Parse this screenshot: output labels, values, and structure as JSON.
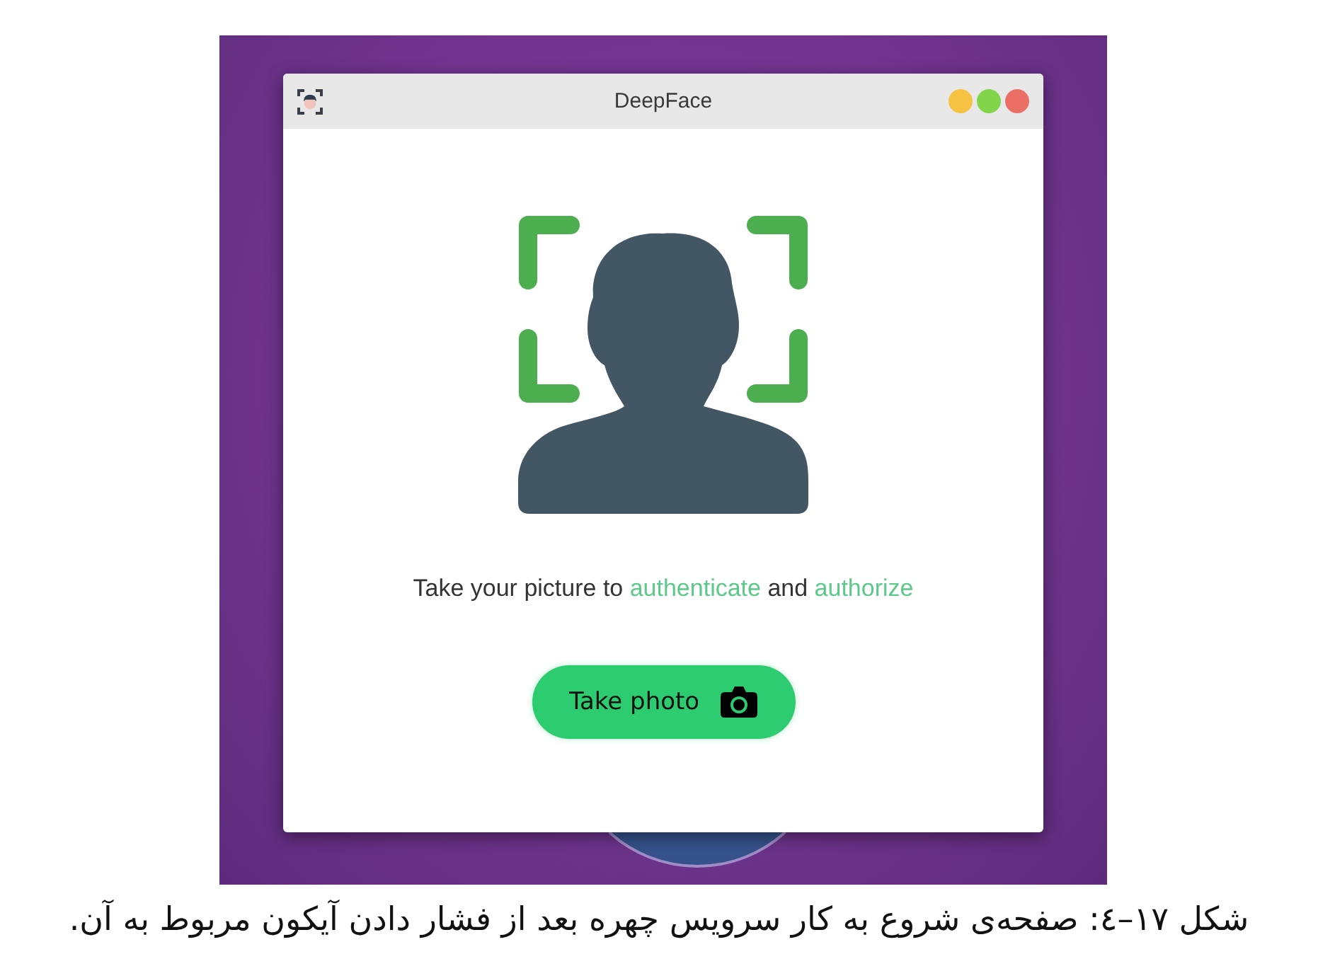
{
  "window": {
    "title": "DeepFace",
    "controls": [
      {
        "color": "#f5c242"
      },
      {
        "color": "#82d44a"
      },
      {
        "color": "#ec6f66"
      }
    ],
    "message": [
      {
        "text": "Take your picture to ",
        "highlight": false
      },
      {
        "text": "authenticate",
        "highlight": true
      },
      {
        "text": " and ",
        "highlight": false
      },
      {
        "text": "authorize",
        "highlight": true
      }
    ],
    "button": {
      "label": "Take photo"
    }
  },
  "caption": "شکل ١٧–٤: صفحه‌ی شروع به کار سرویس چهره بعد از فشار دادن آیکون مربوط به آن."
}
